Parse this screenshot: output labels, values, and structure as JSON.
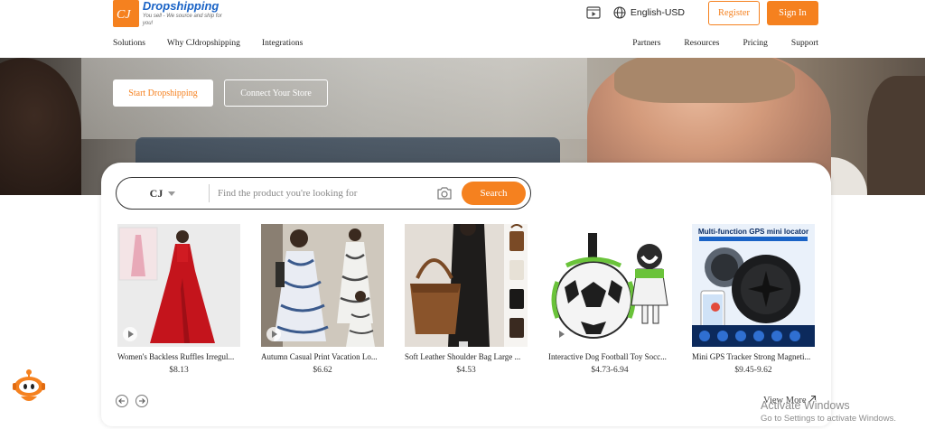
{
  "brand": {
    "name": "Dropshipping",
    "tagline": "You sell - We source and ship for you!",
    "mark": "CJ",
    "color": "#f5811f",
    "text_color": "#1a63c6"
  },
  "header": {
    "video_icon": "video-icon",
    "globe_icon": "globe-icon",
    "language": "English-USD",
    "register": "Register",
    "sign_in": "Sign In"
  },
  "nav": {
    "left": [
      "Solutions",
      "Why CJdropshipping",
      "Integrations"
    ],
    "right": [
      "Partners",
      "Resources",
      "Pricing",
      "Support"
    ]
  },
  "hero": {
    "start": "Start Dropshipping",
    "connect": "Connect Your Store"
  },
  "search": {
    "source": "CJ",
    "placeholder": "Find the product you're looking for",
    "camera_icon": "camera-icon",
    "button": "Search"
  },
  "products": [
    {
      "name": "Women's Backless Ruffles Irregul...",
      "price": "$8.13",
      "video": true
    },
    {
      "name": "Autumn Casual Print Vacation Lo...",
      "price": "$6.62",
      "video": true
    },
    {
      "name": "Soft Leather Shoulder Bag Large ...",
      "price": "$4.53",
      "video": false
    },
    {
      "name": "Interactive Dog Football Toy Socc...",
      "price": "$4.73-6.94",
      "video": true
    },
    {
      "name": "Mini GPS Tracker Strong Magneti...",
      "price": "$9.45-9.62",
      "video": false
    }
  ],
  "gps_banner": {
    "title": "Multi-function GPS mini locator"
  },
  "footer": {
    "view_more": "View More",
    "prev_icon": "arrow-left-icon",
    "next_icon": "arrow-right-icon"
  },
  "watermark": {
    "line1": "Activate Windows",
    "line2": "Go to Settings to activate Windows."
  },
  "assistant_icon": "robot-assistant-icon"
}
